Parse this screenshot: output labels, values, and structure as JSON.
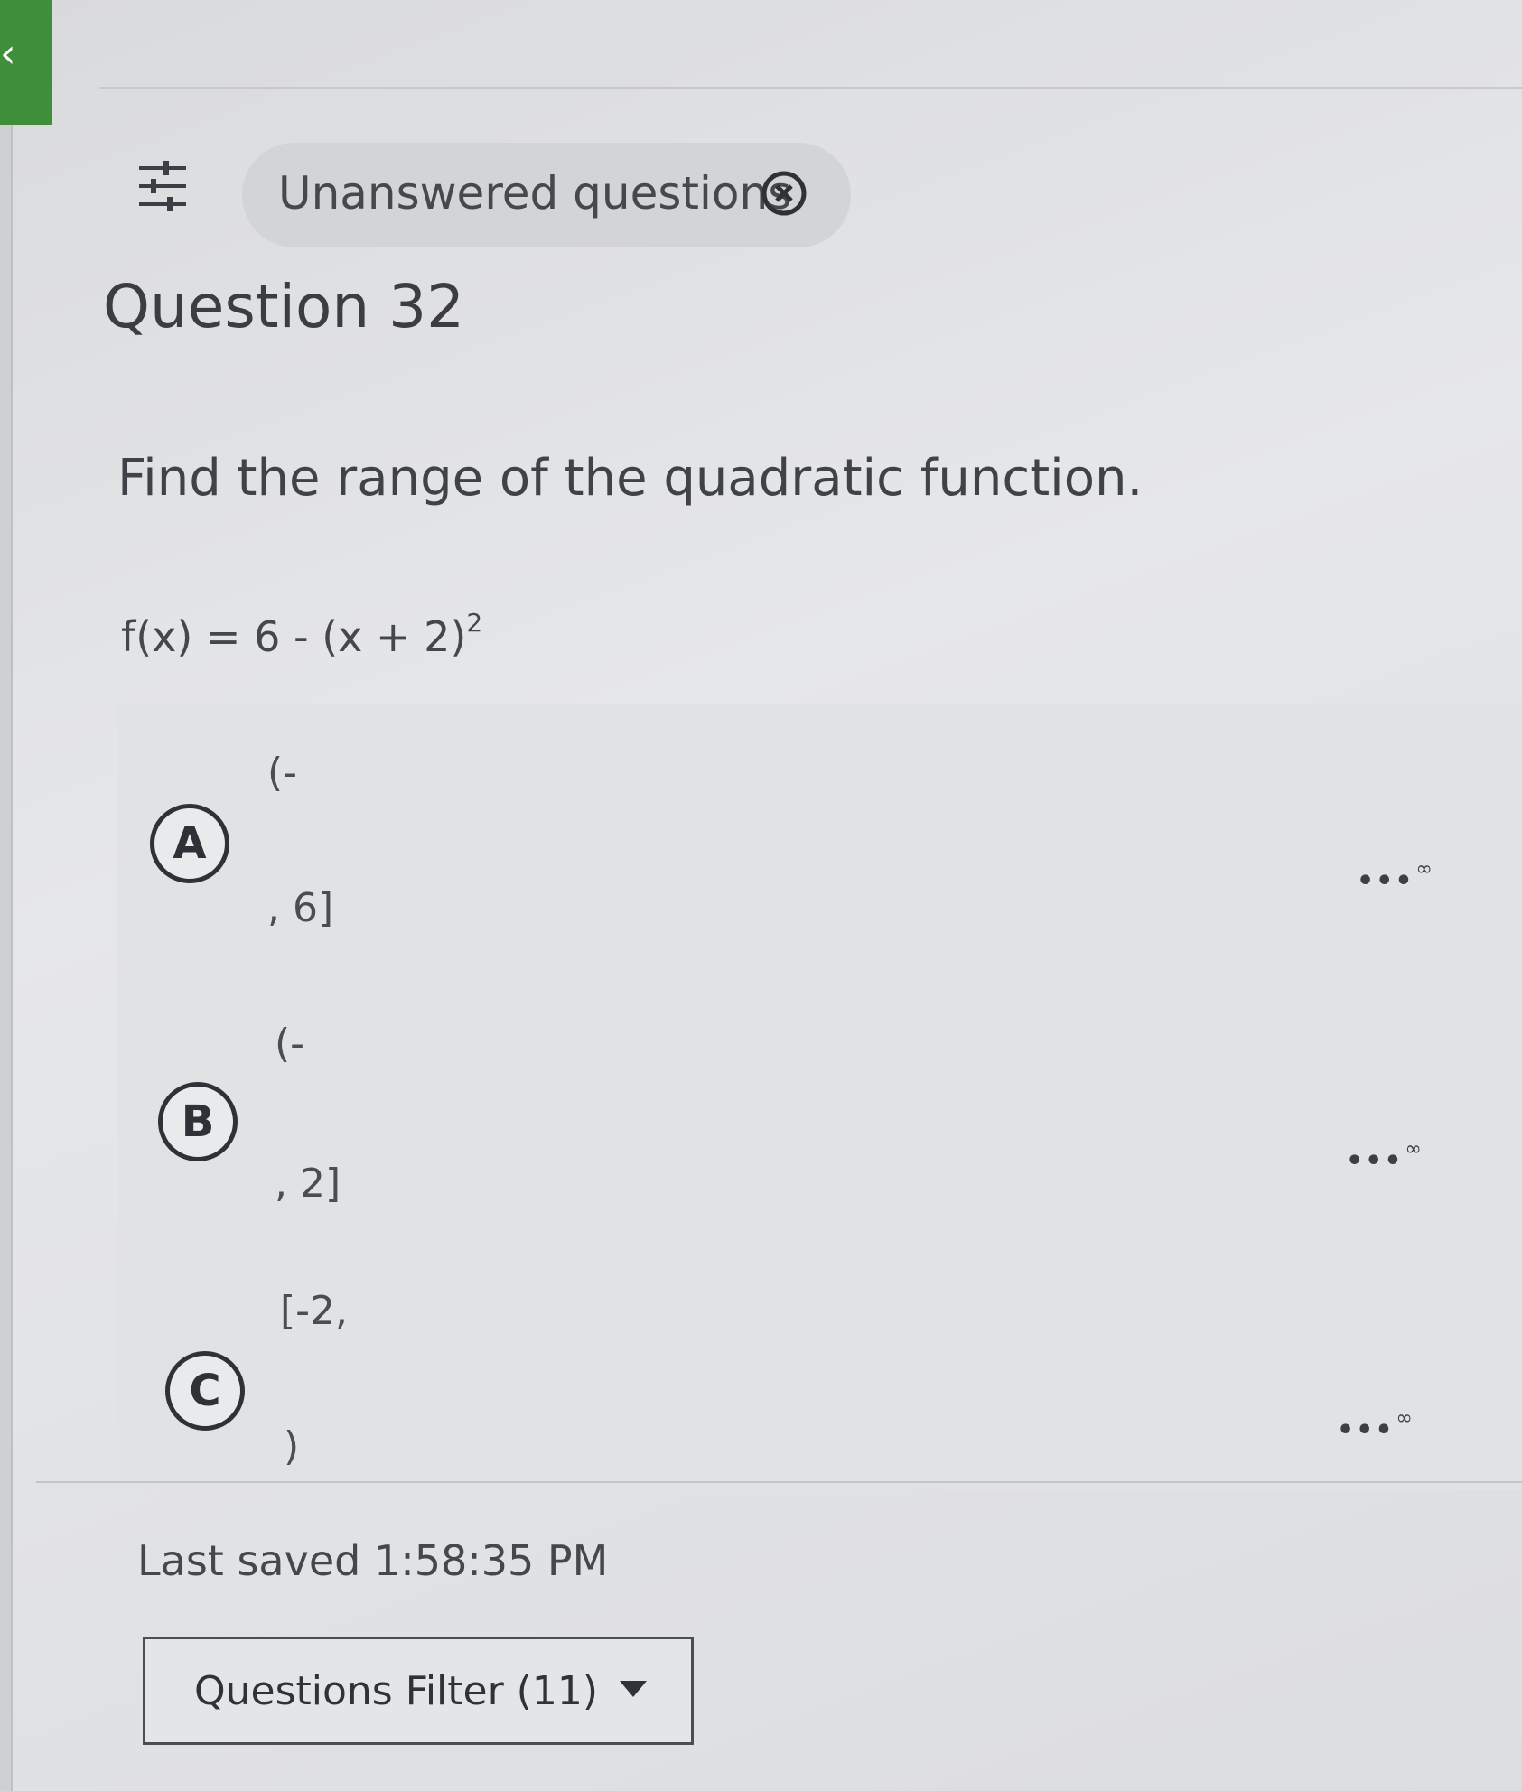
{
  "header": {
    "filter_icon": "sliders-icon",
    "chip": {
      "label": "Unanswered questions",
      "close_icon": "close-circle-icon"
    }
  },
  "question": {
    "title": "Question 32",
    "prompt": "Find the range of the quadratic function.",
    "equation_main": "f(x) = 6 - (x + 2)",
    "equation_exp": "2"
  },
  "options": [
    {
      "letter": "A",
      "top_text": "(-",
      "bottom_text": ", 6]",
      "more_dots": "•••",
      "more_symbol": "∞"
    },
    {
      "letter": "B",
      "top_text": "(-",
      "bottom_text": ", 2]",
      "more_dots": "•••",
      "more_symbol": "∞"
    },
    {
      "letter": "C",
      "top_text": "[-2,",
      "bottom_text": ")",
      "more_dots": "•••",
      "more_symbol": "∞"
    }
  ],
  "footer": {
    "last_saved": "Last saved 1:58:35 PM",
    "filter_button_label": "Questions Filter (11)",
    "filter_caret_icon": "caret-down-icon"
  },
  "colors": {
    "accent_green": "#3f8f3a",
    "text": "#3b3e44"
  }
}
